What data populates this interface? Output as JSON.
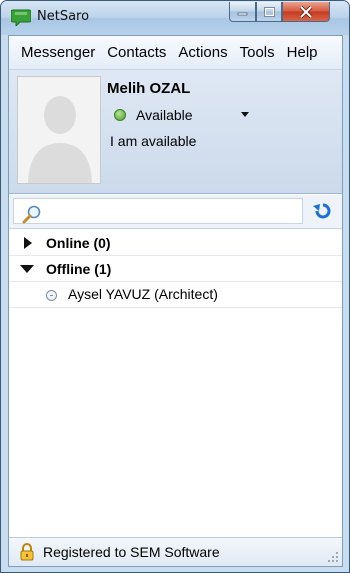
{
  "window": {
    "title": "NetSaro"
  },
  "menu": {
    "items": [
      "Messenger",
      "Contacts",
      "Actions",
      "Tools",
      "Help"
    ]
  },
  "profile": {
    "name": "Melih OZAL",
    "status": "Available",
    "status_message": "I am available",
    "status_color": "#4e9a2c"
  },
  "search": {
    "value": "",
    "placeholder": ""
  },
  "groups": [
    {
      "label": "Online (0)",
      "expanded": false,
      "contacts": []
    },
    {
      "label": "Offline (1)",
      "expanded": true,
      "contacts": [
        {
          "name": "Aysel YAVUZ (Architect)"
        }
      ]
    }
  ],
  "statusbar": {
    "text": "Registered to SEM Software"
  },
  "colors": {
    "accent": "#1f6fd0",
    "frame": "#c8dcf0"
  }
}
